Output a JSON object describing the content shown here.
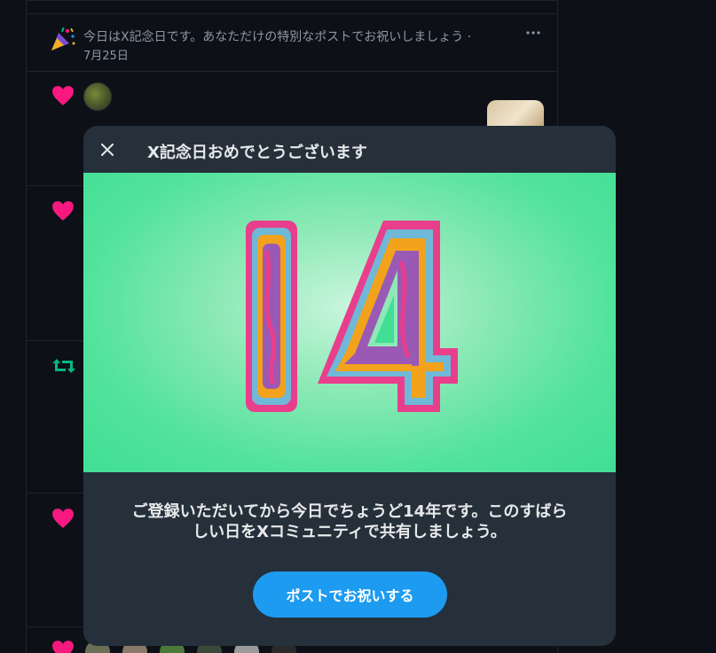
{
  "notice": {
    "text": "今日はX記念日です。あなただけの特別なポストでお祝いしましょう ·",
    "date": "7月25日"
  },
  "icons": {
    "party": "party-popper-icon",
    "more": "more-horizontal-icon",
    "heart": "heart-icon",
    "retweet": "retweet-icon",
    "close": "close-icon"
  },
  "colors": {
    "background": "#0d1117",
    "heart": "#f91880",
    "retweet": "#00ba7c",
    "modal": "#25303b",
    "hero_green": "#41de95",
    "button": "#1d9bf0"
  },
  "modal": {
    "title": "X記念日おめでとうございます",
    "hero_number": "14",
    "message_line1": "ご登録いただいてから今日でちょうど14年です。このすばら",
    "message_line2": "しい日をXコミュニティで共有しましょう。",
    "button_label": "ポストでお祝いする"
  }
}
